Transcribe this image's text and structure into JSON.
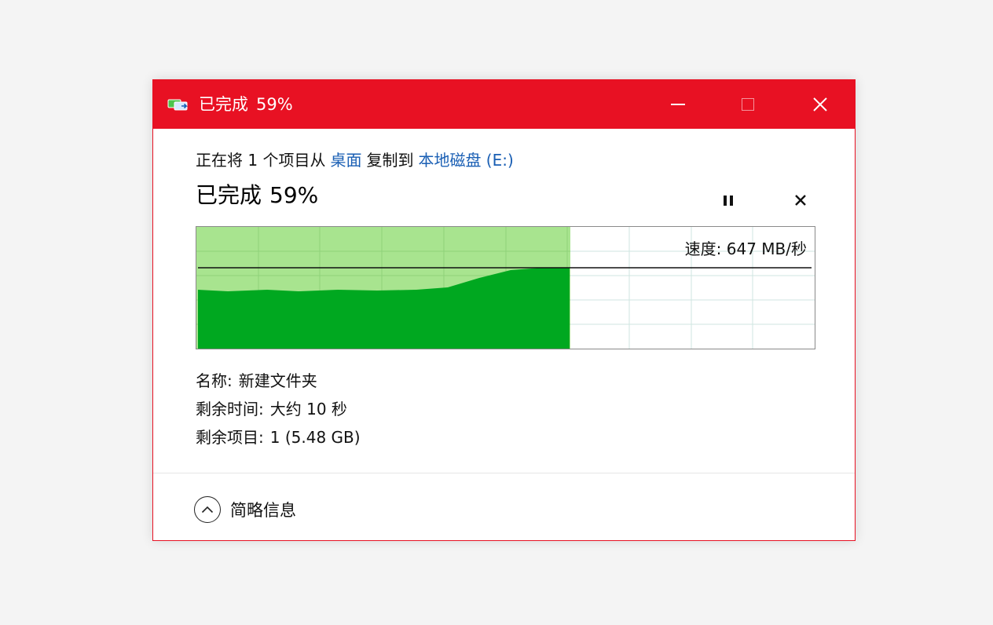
{
  "window": {
    "title_prefix": "已完成",
    "title_percent": "59%",
    "accent_color": "#e81123"
  },
  "copy_info": {
    "text_before": "正在将 1 个项目从",
    "source": "桌面",
    "text_middle": "复制到",
    "destination": "本地磁盘 (E:)"
  },
  "status": {
    "prefix": "已完成",
    "percent": "59%",
    "progress_fraction": 0.59
  },
  "speed": {
    "label": "速度:",
    "value": "647 MB/秒"
  },
  "details": {
    "name_label": "名称:",
    "name_value": "新建文件夹",
    "time_label": "剩余时间:",
    "time_value": "大约 10 秒",
    "items_label": "剩余项目:",
    "items_value": "1 (5.48 GB)"
  },
  "footer": {
    "summary_label": "简略信息"
  },
  "icons": {
    "app": "copy-transfer-icon",
    "minimize": "minimize-icon",
    "maximize": "maximize-icon",
    "close": "close-icon",
    "pause": "pause-icon",
    "cancel": "cancel-icon",
    "collapse": "chevron-up-icon"
  }
}
